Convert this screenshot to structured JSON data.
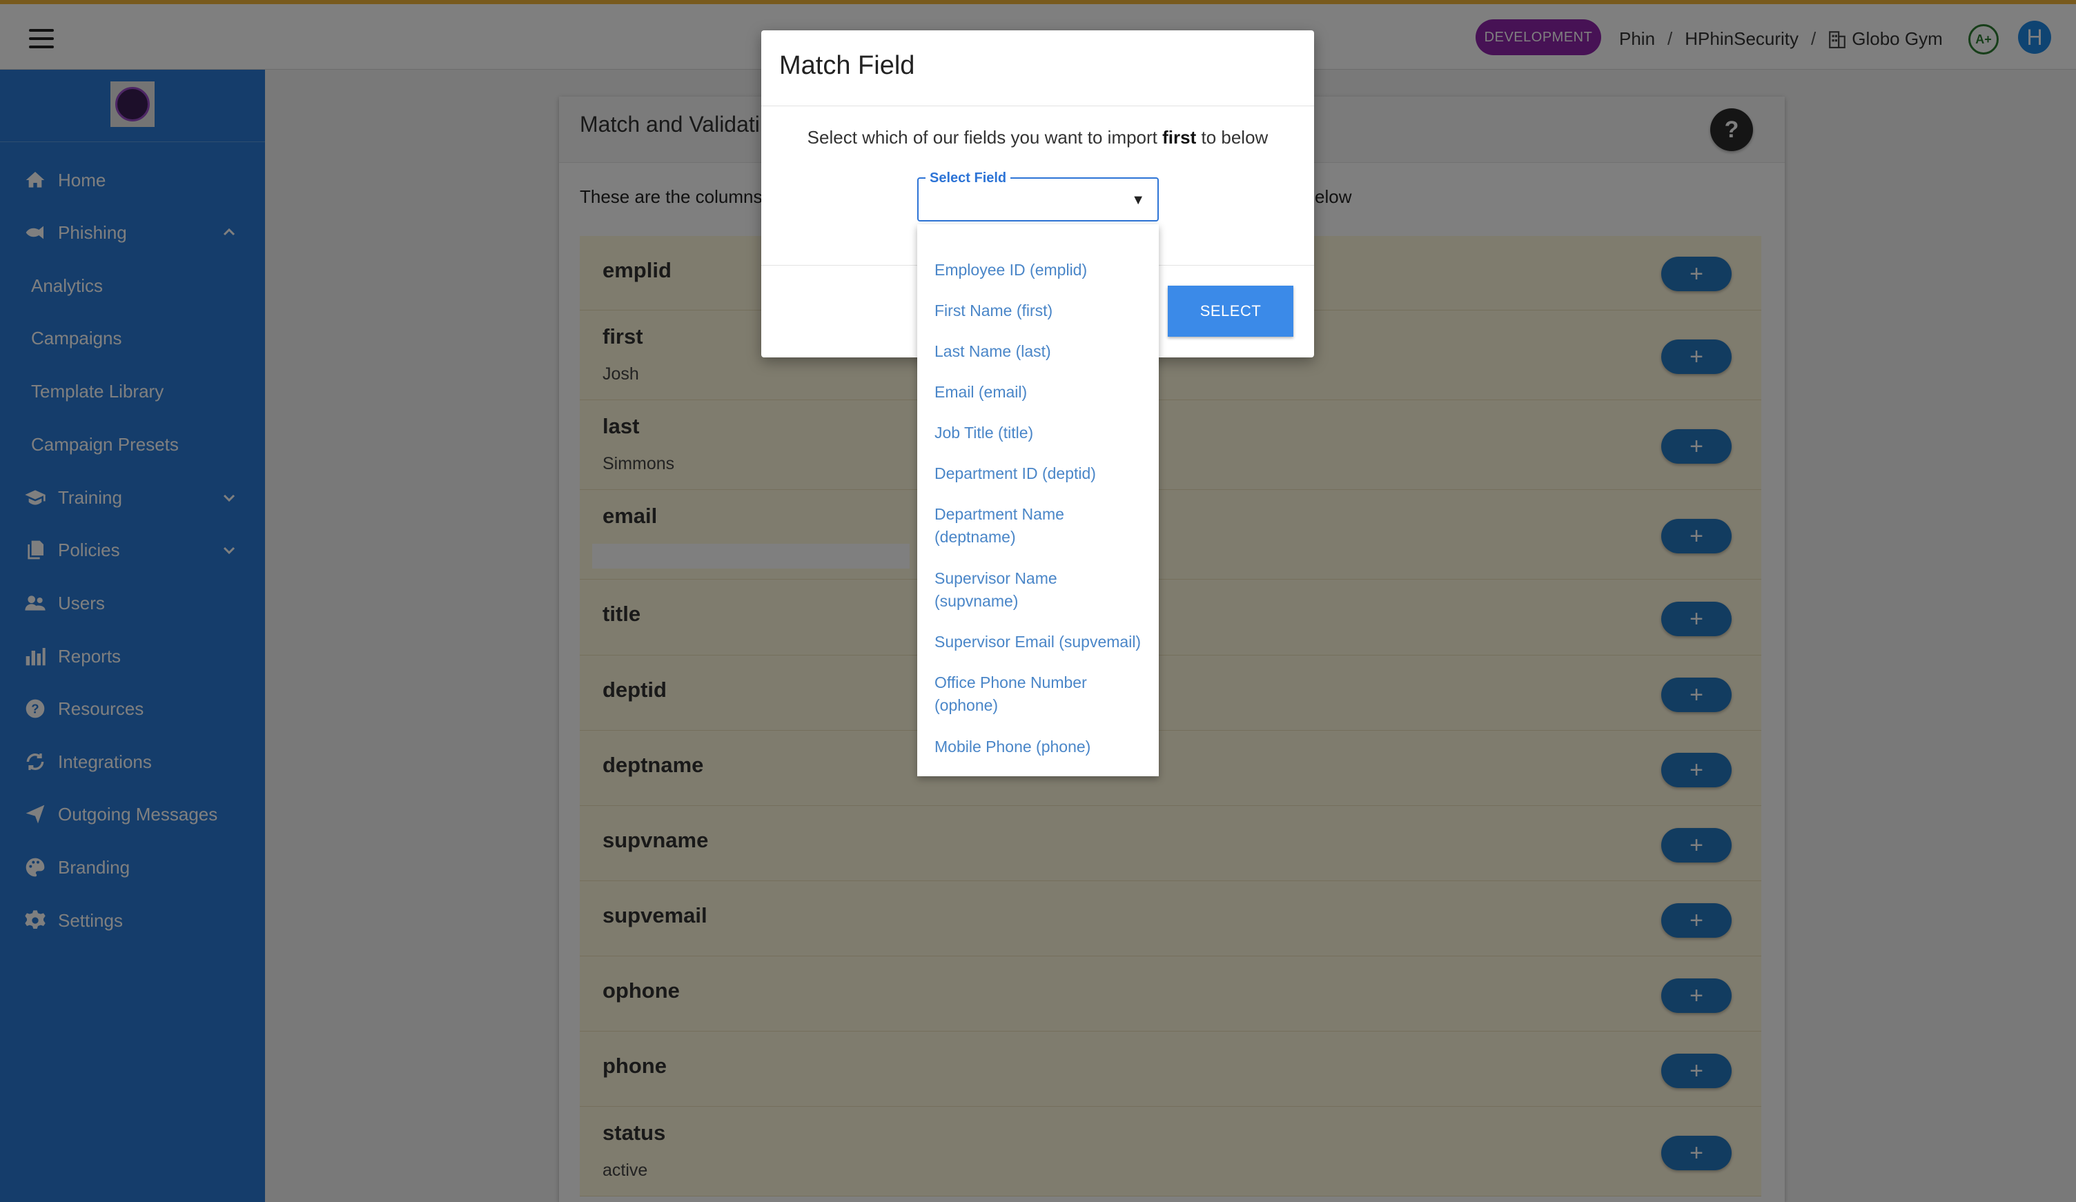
{
  "header": {
    "env_badge": "DEVELOPMENT",
    "breadcrumb": [
      "Phin",
      "HPhinSecurity",
      "Globo Gym"
    ],
    "grade": "A+",
    "avatar_initial": "H"
  },
  "sidebar": {
    "items": [
      {
        "label": "Home",
        "icon": "home-icon"
      },
      {
        "label": "Phishing",
        "icon": "fish-icon",
        "expanded": true
      },
      {
        "label": "Analytics"
      },
      {
        "label": "Campaigns"
      },
      {
        "label": "Template Library"
      },
      {
        "label": "Campaign Presets"
      },
      {
        "label": "Training",
        "icon": "graduation-cap-icon"
      },
      {
        "label": "Policies",
        "icon": "documents-icon"
      },
      {
        "label": "Users",
        "icon": "users-icon"
      },
      {
        "label": "Reports",
        "icon": "bar-chart-icon"
      },
      {
        "label": "Resources",
        "icon": "question-circle-icon"
      },
      {
        "label": "Integrations",
        "icon": "sync-icon"
      },
      {
        "label": "Outgoing Messages",
        "icon": "paper-plane-icon"
      },
      {
        "label": "Branding",
        "icon": "palette-icon"
      },
      {
        "label": "Settings",
        "icon": "gear-icon"
      }
    ]
  },
  "card": {
    "title": "Match and Validati",
    "help": "?",
    "desc_left": "These are the columns",
    "desc_right": "elow",
    "rows": [
      {
        "name": "emplid",
        "value": ""
      },
      {
        "name": "first",
        "value": "Josh"
      },
      {
        "name": "last",
        "value": "Simmons"
      },
      {
        "name": "email",
        "value": ""
      },
      {
        "name": "title",
        "value": ""
      },
      {
        "name": "deptid",
        "value": ""
      },
      {
        "name": "deptname",
        "value": ""
      },
      {
        "name": "supvname",
        "value": ""
      },
      {
        "name": "supvemail",
        "value": ""
      },
      {
        "name": "ophone",
        "value": ""
      },
      {
        "name": "phone",
        "value": ""
      },
      {
        "name": "status",
        "value": "active"
      }
    ],
    "add_label": "+"
  },
  "modal": {
    "title": "Match Field",
    "prompt_before": "Select which of our fields you want to import ",
    "prompt_field": "first",
    "prompt_after": " to below",
    "select_label": "Select Field",
    "select_value": "",
    "select_arrow": "▼",
    "options": [
      "Employee ID (emplid)",
      "First Name (first)",
      "Last Name (last)",
      "Email (email)",
      "Job Title (title)",
      "Department ID (deptid)",
      "Department Name (deptname)",
      "Supervisor Name (supvname)",
      "Supervisor Email (supvemail)",
      "Office Phone Number (ophone)",
      "Mobile Phone (phone)"
    ],
    "select_button": "SELECT"
  },
  "colors": {
    "top_accent": "#f0b43a",
    "sidebar": "#2a7bd6",
    "env_badge": "#8e24aa",
    "primary_button": "#3b8ae8",
    "add_button": "#2479c1",
    "row_bg": "#fff8dd",
    "option_text": "#4a86c8"
  }
}
